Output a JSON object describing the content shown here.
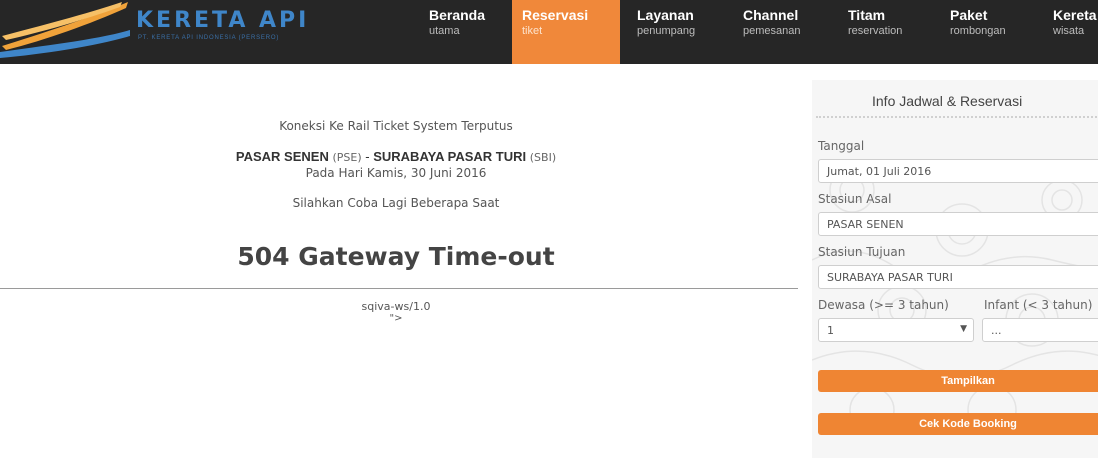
{
  "brand": {
    "name": "KERETA API",
    "tagline": "PT. KERETA API INDONESIA (PERSERO)"
  },
  "nav": [
    {
      "label": "Beranda",
      "sub": "utama"
    },
    {
      "label": "Reservasi",
      "sub": "tiket",
      "active": true
    },
    {
      "label": "Layanan",
      "sub": "penumpang"
    },
    {
      "label": "Channel",
      "sub": "pemesanan"
    },
    {
      "label": "Titam",
      "sub": "reservation"
    },
    {
      "label": "Paket",
      "sub": "rombongan"
    },
    {
      "label": "Kereta",
      "sub": "wisata"
    }
  ],
  "main": {
    "connection_msg": "Koneksi Ke Rail Ticket System Terputus",
    "route": {
      "origin": "PASAR SENEN",
      "origin_code": "(PSE)",
      "separator": "-",
      "destination": "SURABAYA PASAR TURI",
      "destination_code": "(SBI)"
    },
    "date_line": "Pada Hari Kamis, 30 Juni 2016",
    "retry_msg": "Silahkan Coba Lagi Beberapa Saat",
    "error_title": "504 Gateway Time-out",
    "server": "sqiva-ws/1.0",
    "stray": "\">"
  },
  "sidebar": {
    "title": "Info Jadwal & Reservasi",
    "date_label": "Tanggal",
    "date_value": "Jumat, 01 Juli 2016",
    "origin_label": "Stasiun Asal",
    "origin_value": "PASAR SENEN",
    "dest_label": "Stasiun Tujuan",
    "dest_value": "SURABAYA PASAR TURI",
    "adult_label": "Dewasa (>= 3 tahun)",
    "adult_value": "1",
    "infant_label": "Infant (< 3 tahun)",
    "infant_value": "...",
    "show_button": "Tampilkan",
    "check_button": "Cek Kode Booking"
  },
  "colors": {
    "accent": "#f0883a",
    "topbar": "#262626",
    "brand_blue": "#3f86c9"
  }
}
